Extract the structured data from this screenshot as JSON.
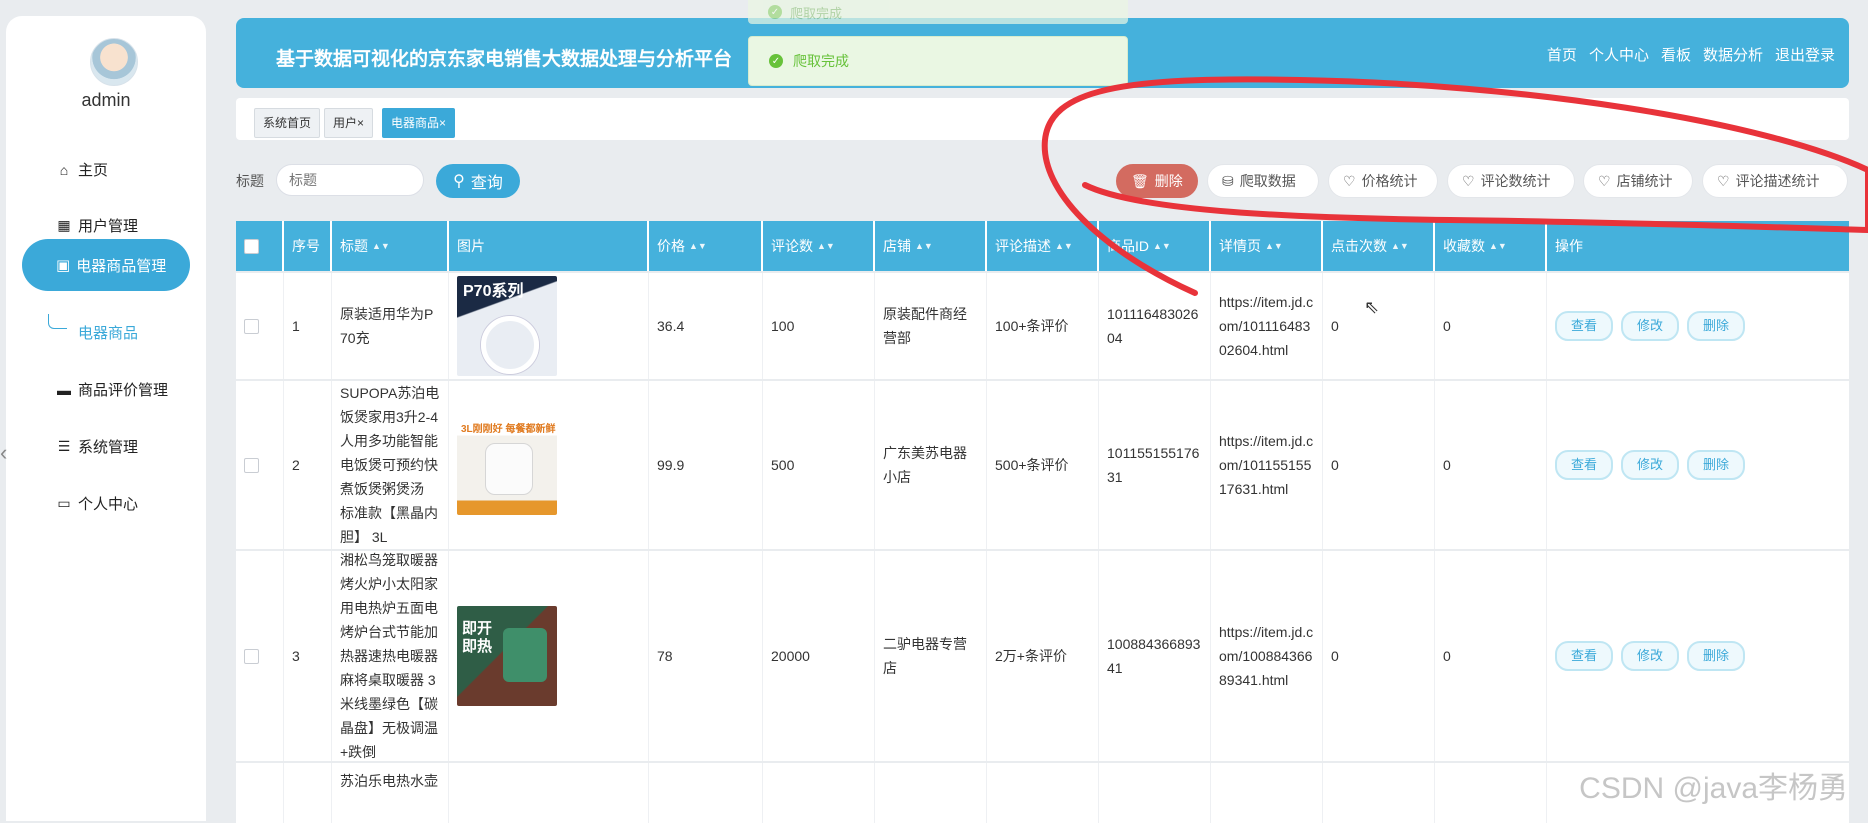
{
  "user": {
    "name": "admin"
  },
  "sidebar": {
    "items": [
      {
        "label": "主页",
        "icon": "home-icon"
      },
      {
        "label": "用户管理",
        "icon": "grid-icon"
      },
      {
        "label": "电器商品管理",
        "icon": "clipboard-icon"
      },
      {
        "label": "商品评价管理",
        "icon": "print-icon"
      },
      {
        "label": "系统管理",
        "icon": "sliders-icon"
      },
      {
        "label": "个人中心",
        "icon": "card-icon"
      }
    ],
    "sub_item": "电器商品"
  },
  "header": {
    "title": "基于数据可视化的京东家电销售大数据处理与分析平台",
    "nav": [
      "首页",
      "个人中心",
      "看板",
      "数据分析",
      "退出登录"
    ]
  },
  "toast": {
    "faded": "爬取完成",
    "message": "爬取完成"
  },
  "tabs": [
    "系统首页",
    "用户×",
    "电器商品×"
  ],
  "search": {
    "label": "标题",
    "placeholder": "标题",
    "button": "查询"
  },
  "actions": [
    "删除",
    "爬取数据",
    "价格统计",
    "评论数统计",
    "店铺统计",
    "评论描述统计"
  ],
  "table": {
    "columns": [
      "序号",
      "标题",
      "图片",
      "价格",
      "评论数",
      "店铺",
      "评论描述",
      "商品ID",
      "详情页",
      "点击次数",
      "收藏数",
      "操作"
    ],
    "op_buttons": [
      "查看",
      "修改",
      "删除"
    ],
    "rows": [
      {
        "no": "1",
        "title": "原装适用华为P70充",
        "image_label": "P70系列",
        "price": "36.4",
        "comments": "100",
        "shop": "原装配件商经营部",
        "comment_desc": "100+条评价",
        "id": "10111648302604",
        "url": "https://item.jd.com/10111648302604.html",
        "clicks": "0",
        "favs": "0"
      },
      {
        "no": "2",
        "title": "SUPOPA苏泊电饭煲家用3升2-4人用多功能智能电饭煲可预约快煮饭煲粥煲汤 标准款【黑晶内胆】 3L",
        "image_label": "3L刚刚好 每餐都新鲜",
        "price": "99.9",
        "comments": "500",
        "shop": "广东美苏电器小店",
        "comment_desc": "500+条评价",
        "id": "10115515517631",
        "url": "https://item.jd.com/10115515517631.html",
        "clicks": "0",
        "favs": "0"
      },
      {
        "no": "3",
        "title": "湘松鸟笼取暖器烤火炉小太阳家用电热炉五面电烤炉台式节能加热器速热电暖器麻将桌取暖器 3米线墨绿色【碳晶盘】无极调温+跌倒",
        "image_label": "即开即热",
        "price": "78",
        "comments": "20000",
        "shop": "二驴电器专营店",
        "comment_desc": "2万+条评价",
        "id": "10088436689341",
        "url": "https://item.jd.com/10088436689341.html",
        "clicks": "0",
        "favs": "0"
      },
      {
        "no": "",
        "title": "苏泊乐电热水壶",
        "image_label": "",
        "price": "",
        "comments": "",
        "shop": "",
        "comment_desc": "",
        "id": "",
        "url": "",
        "clicks": "",
        "favs": ""
      }
    ]
  },
  "watermark": "CSDN @java李杨勇",
  "colors": {
    "primary": "#45b1dc",
    "danger": "#d36b60",
    "annotation": "#e8333a",
    "success": "#67c23a"
  }
}
